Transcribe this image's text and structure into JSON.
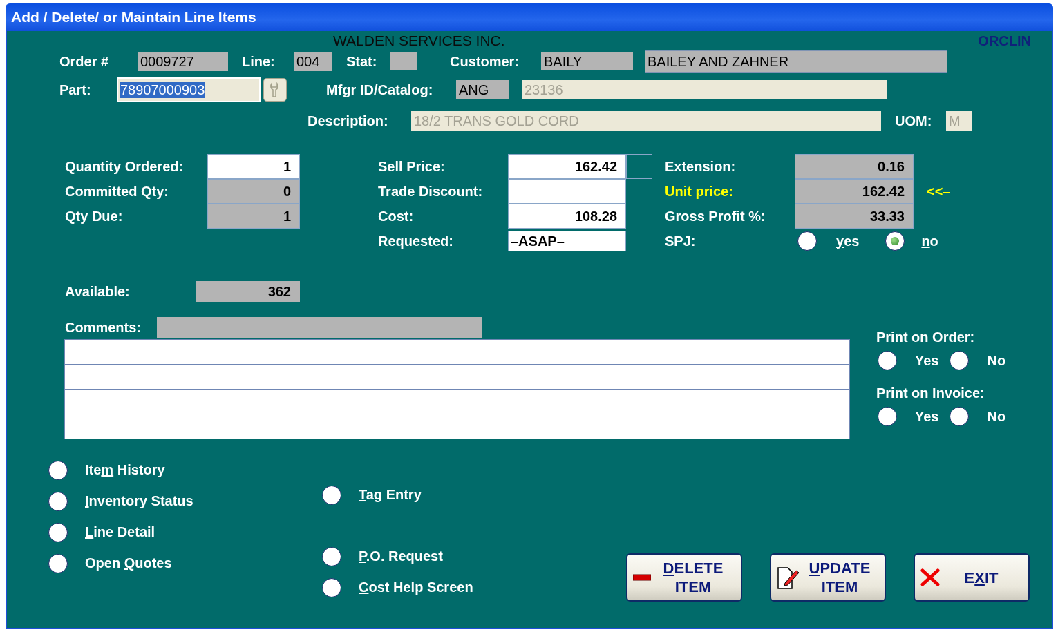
{
  "window": {
    "title": "Add / Delete/ or Maintain Line Items"
  },
  "company": "WALDEN SERVICES INC.",
  "program_code": "ORCLIN",
  "order": {
    "label": "Order #",
    "value": "0009727"
  },
  "line": {
    "label": "Line:",
    "value": "004"
  },
  "stat": {
    "label": "Stat:"
  },
  "customer": {
    "label": "Customer:",
    "code": "BAILY",
    "name": "BAILEY AND ZAHNER"
  },
  "part": {
    "label": "Part:",
    "value": "78907000903",
    "selected": true
  },
  "mfgr": {
    "label": "Mfgr ID/Catalog:",
    "id": "ANG",
    "catalog": "23136",
    "disabled": true
  },
  "description": {
    "label": "Description:",
    "value": "18/2 TRANS GOLD CORD",
    "disabled": true
  },
  "uom": {
    "label": "UOM:",
    "value": "M",
    "disabled": true
  },
  "quantities": [
    {
      "label": "Quantity Ordered:",
      "value": "1",
      "editable": true
    },
    {
      "label": "Committed Qty:",
      "value": "0",
      "editable": false
    },
    {
      "label": "Qty Due:",
      "value": "1",
      "editable": false
    }
  ],
  "pricing": [
    {
      "label": "Sell Price:",
      "value": "162.42",
      "editable": true
    },
    {
      "label": "Trade Discount:",
      "editable": true
    },
    {
      "label": "Cost:",
      "value": "108.28",
      "editable": true
    },
    {
      "label": "Requested:",
      "value": "–ASAP–",
      "editable": true
    }
  ],
  "results": [
    {
      "label": "Extension:",
      "value": "0.16",
      "highlight": false
    },
    {
      "label": "Unit price:",
      "value": "162.42",
      "highlight": true,
      "marker": "<<–"
    },
    {
      "label": "Gross Profit %:",
      "value": "33.33",
      "highlight": false
    }
  ],
  "spj": {
    "label": "SPJ:",
    "options": [
      {
        "label": {
          "key": "y",
          "after": "es"
        },
        "selected": false
      },
      {
        "label": {
          "key": "n",
          "after": "o"
        },
        "selected": true
      }
    ]
  },
  "available": {
    "label": "Available:",
    "value": "362"
  },
  "comments": {
    "label": "Comments:"
  },
  "print_on_order": {
    "label": "Print on Order:",
    "options": [
      {
        "label": {
          "before": "Yes"
        },
        "selected": false
      },
      {
        "label": {
          "before": "No"
        },
        "selected": false
      }
    ]
  },
  "print_on_invoice": {
    "label": "Print on Invoice:",
    "options": [
      {
        "label": {
          "before": "Yes"
        },
        "selected": false
      },
      {
        "label": {
          "before": "No"
        },
        "selected": false
      }
    ]
  },
  "screens_left": [
    {
      "label": {
        "before": "Ite",
        "key": "m",
        "after": " History"
      },
      "selected": false
    },
    {
      "label": {
        "key": "I",
        "after": "nventory Status"
      },
      "selected": false
    },
    {
      "label": {
        "key": "L",
        "after": "ine Detail"
      },
      "selected": false
    },
    {
      "label": {
        "before": "Open ",
        "key": "Q",
        "after": "uotes"
      },
      "selected": false
    }
  ],
  "screens_right": [
    {
      "label": {
        "key": "T",
        "after": "ag Entry"
      },
      "selected": false
    },
    {
      "label": {
        "key": "P",
        "after": ".O. Request"
      },
      "selected": false
    },
    {
      "label": {
        "key": "C",
        "after": "ost Help Screen"
      },
      "selected": false
    }
  ],
  "buttons": [
    {
      "kind": "delete",
      "lines": [
        {
          "key": "D",
          "after": "ELETE"
        },
        {
          "before": "ITEM"
        }
      ]
    },
    {
      "kind": "update",
      "lines": [
        {
          "key": "U",
          "after": "PDATE"
        },
        {
          "before": "ITEM"
        }
      ]
    },
    {
      "kind": "exit",
      "lines": [
        {
          "before": "E",
          "key": "X",
          "after": "IT"
        }
      ]
    }
  ]
}
